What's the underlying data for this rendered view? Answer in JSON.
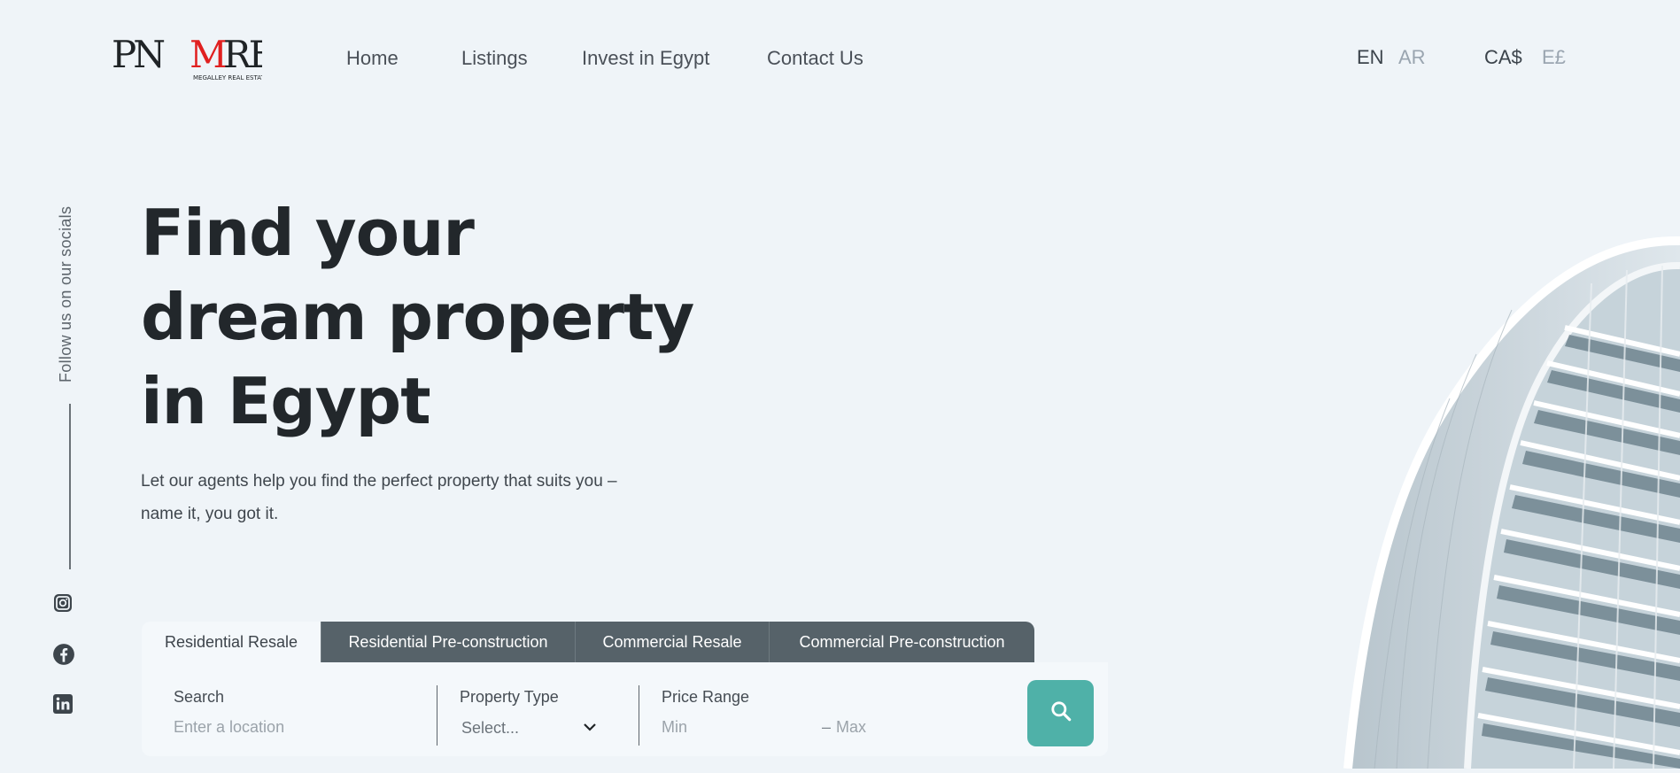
{
  "brand": {
    "logo_alt": "MRE",
    "tagline": "MEGALLEY REAL ESTATE"
  },
  "nav": {
    "items": [
      {
        "label": "Home"
      },
      {
        "label": "Listings"
      },
      {
        "label": "Invest in Egypt"
      },
      {
        "label": "Contact Us"
      }
    ]
  },
  "language": {
    "active": "EN",
    "inactive": "AR"
  },
  "currency": {
    "active": "CA$",
    "inactive": "E£"
  },
  "social": {
    "follow_label": "Follow us on our socials",
    "icons": [
      "instagram-icon",
      "facebook-icon",
      "linkedin-icon"
    ]
  },
  "hero": {
    "title": "Find your dream property in Egypt",
    "subtitle": "Let our agents help you find the perfect property that suits you – name it, you got it."
  },
  "search": {
    "tabs": [
      {
        "label": "Residential Resale",
        "selected": true
      },
      {
        "label": "Residential Pre-construction",
        "selected": false
      },
      {
        "label": "Commercial Resale",
        "selected": false
      },
      {
        "label": "Commercial Pre-construction",
        "selected": false
      }
    ],
    "search_label": "Search",
    "search_placeholder": "Enter a location",
    "type_label": "Property Type",
    "type_value": "Select...",
    "price_label": "Price Range",
    "min_placeholder": "Min",
    "max_placeholder": "Max",
    "separator": "–"
  },
  "colors": {
    "accent": "#4fb1a8",
    "tab_dark": "#566269",
    "background": "#eff4f8"
  }
}
